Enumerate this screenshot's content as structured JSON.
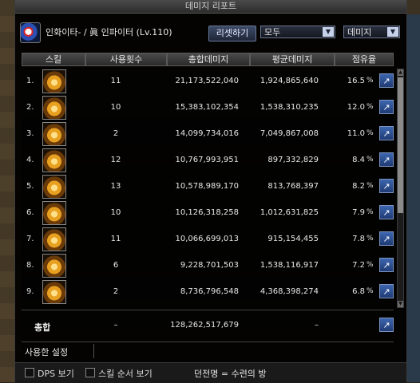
{
  "window": {
    "title": "데미지 리포트"
  },
  "header": {
    "character": "인화이타- / 眞 인파이터 (Lv.110)",
    "reset_label": "리셋하기",
    "filter_select": "모두",
    "metric_select": "데미지"
  },
  "columns": [
    "스킬",
    "사용횟수",
    "총합데미지",
    "평균데미지",
    "점유율"
  ],
  "rows": [
    {
      "index": "1.",
      "count": "11",
      "total": "21,173,522,040",
      "avg": "1,924,865,640",
      "share": "16.5"
    },
    {
      "index": "2.",
      "count": "10",
      "total": "15,383,102,354",
      "avg": "1,538,310,235",
      "share": "12.0"
    },
    {
      "index": "3.",
      "count": "2",
      "total": "14,099,734,016",
      "avg": "7,049,867,008",
      "share": "11.0"
    },
    {
      "index": "4.",
      "count": "12",
      "total": "10,767,993,951",
      "avg": "897,332,829",
      "share": "8.4"
    },
    {
      "index": "5.",
      "count": "13",
      "total": "10,578,989,170",
      "avg": "813,768,397",
      "share": "8.2"
    },
    {
      "index": "6.",
      "count": "10",
      "total": "10,126,318,258",
      "avg": "1,012,631,825",
      "share": "7.9"
    },
    {
      "index": "7.",
      "count": "11",
      "total": "10,066,699,013",
      "avg": "915,154,455",
      "share": "7.8"
    },
    {
      "index": "8.",
      "count": "6",
      "total": "9,228,701,503",
      "avg": "1,538,116,917",
      "share": "7.2"
    },
    {
      "index": "9.",
      "count": "2",
      "total": "8,736,796,548",
      "avg": "4,368,398,274",
      "share": "6.8"
    }
  ],
  "percent_sign": "%",
  "total": {
    "label": "총합",
    "count": "–",
    "total": "128,262,517,679",
    "avg": "–"
  },
  "settings": {
    "label": "사용한 설정"
  },
  "footer": {
    "dps_label": "DPS 보기",
    "skill_order_label": "스킬 순서 보기",
    "dungeon": "던전명 = 수련의 방"
  },
  "icons": {
    "share": "share-arrow-icon",
    "dropdown": "chevron-down-icon"
  },
  "colors": {
    "button_blue": "#1f3b74",
    "header_bg": "#2a2a2a"
  }
}
